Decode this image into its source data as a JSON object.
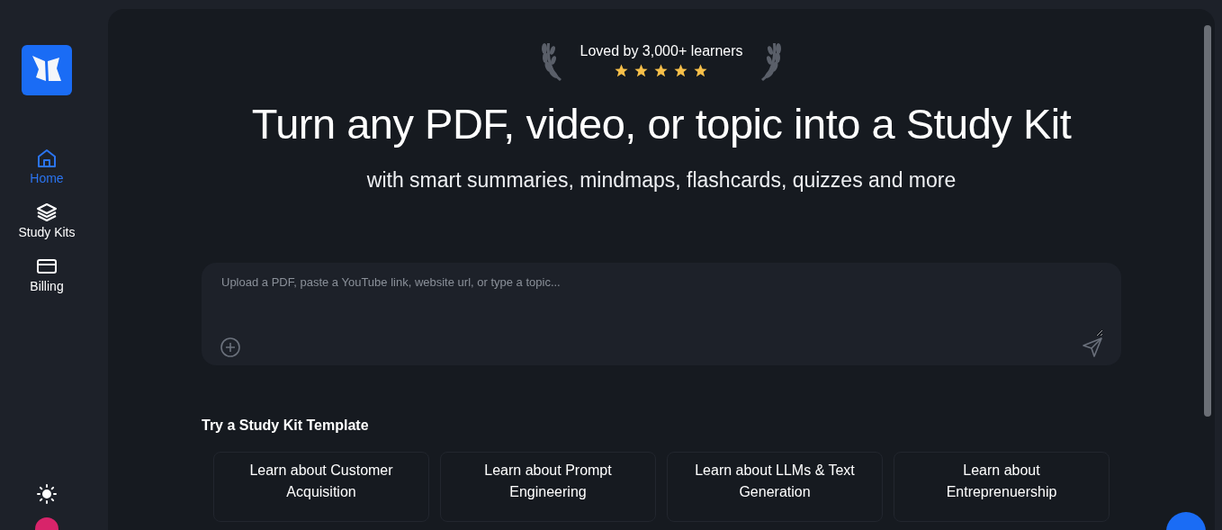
{
  "sidebar": {
    "items": [
      {
        "label": "Home",
        "kind": "home",
        "selected": true
      },
      {
        "label": "Study Kits",
        "kind": "layers",
        "selected": false
      },
      {
        "label": "Billing",
        "kind": "card",
        "selected": false
      }
    ]
  },
  "badge": {
    "text": "Loved by 3,000+ learners",
    "stars": 5
  },
  "hero": {
    "title": "Turn any PDF, video, or topic into a Study Kit",
    "subtitle": "with smart summaries, mindmaps, flashcards, quizzes and more"
  },
  "input": {
    "placeholder": "Upload a PDF, paste a YouTube link, website url, or type a topic..."
  },
  "templates": {
    "heading": "Try a Study Kit Template",
    "items": [
      "Learn about Customer Acquisition",
      "Learn about Prompt Engineering",
      "Learn about LLMs & Text Generation",
      "Learn about Entreprenuership"
    ]
  }
}
